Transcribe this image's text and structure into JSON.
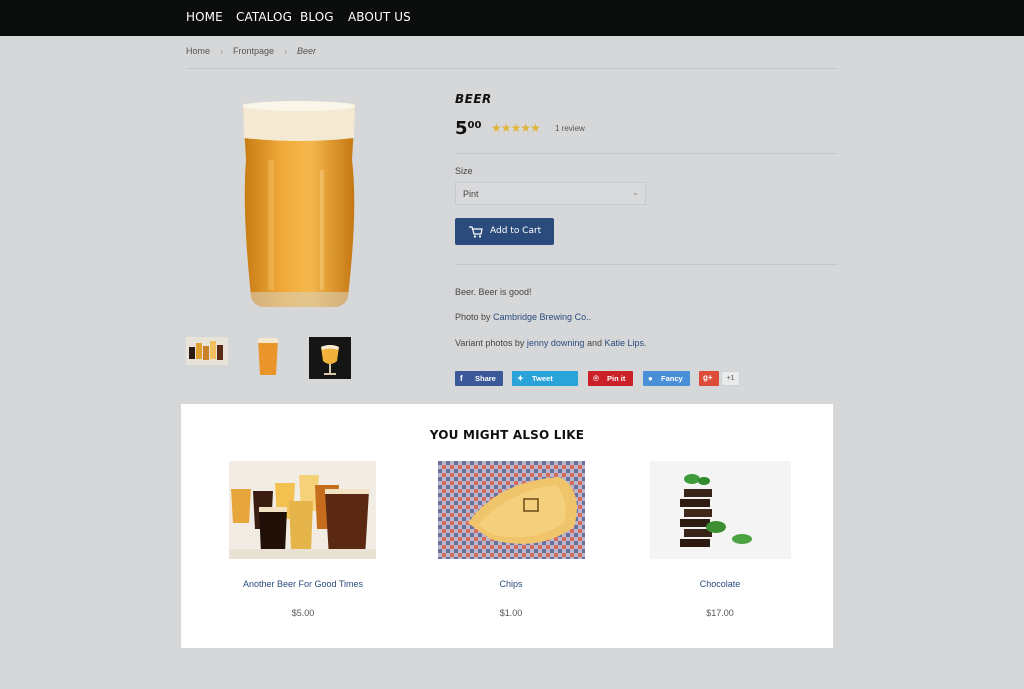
{
  "nav": {
    "items": [
      "HOME",
      "CATALOG",
      "BLOG",
      "ABOUT US"
    ]
  },
  "breadcrumb": {
    "home": "Home",
    "collection": "Frontpage",
    "current": "Beer"
  },
  "product": {
    "title": "BEER",
    "price_main": "5",
    "price_cents": "00",
    "rating": 5,
    "stars": "★★★★★",
    "reviews": "1 review",
    "size_label": "Size",
    "size_value": "Pint",
    "add_to_cart": "Add to Cart",
    "description": "Beer. Beer is good!",
    "photo_prefix": "Photo by ",
    "photo_credit": "Cambridge Brewing Co.",
    "photo_suffix": ".",
    "variant_prefix": "Variant photos by ",
    "variant_credit_1": "jenny downing",
    "variant_and": " and ",
    "variant_credit_2": "Katie Lips",
    "variant_suffix": "."
  },
  "share": {
    "facebook": "Share",
    "twitter": "Tweet",
    "pinterest": "Pin it",
    "fancy": "Fancy",
    "gplus_icon": "g+",
    "gplus_count": "+1"
  },
  "related": {
    "heading": "YOU MIGHT ALSO LIKE",
    "items": [
      {
        "name": "Another Beer For Good Times",
        "price": "$5.00"
      },
      {
        "name": "Chips",
        "price": "$1.00"
      },
      {
        "name": "Chocolate",
        "price": "$17.00"
      }
    ]
  },
  "colors": {
    "nav_bg": "#0b0c0c",
    "page_bg": "#d6d7d9",
    "accent": "#2a4b7c",
    "star": "#e0b53a",
    "facebook": "#3b5998",
    "twitter": "#2aa3d8",
    "pinterest": "#cb2027",
    "fancy": "#4a90d9",
    "gplus": "#dd4b39"
  },
  "icons": [
    "cart-icon",
    "facebook-icon",
    "twitter-icon",
    "pinterest-icon",
    "fancy-icon",
    "google-plus-icon",
    "chevron-down-icon",
    "star-icon"
  ]
}
